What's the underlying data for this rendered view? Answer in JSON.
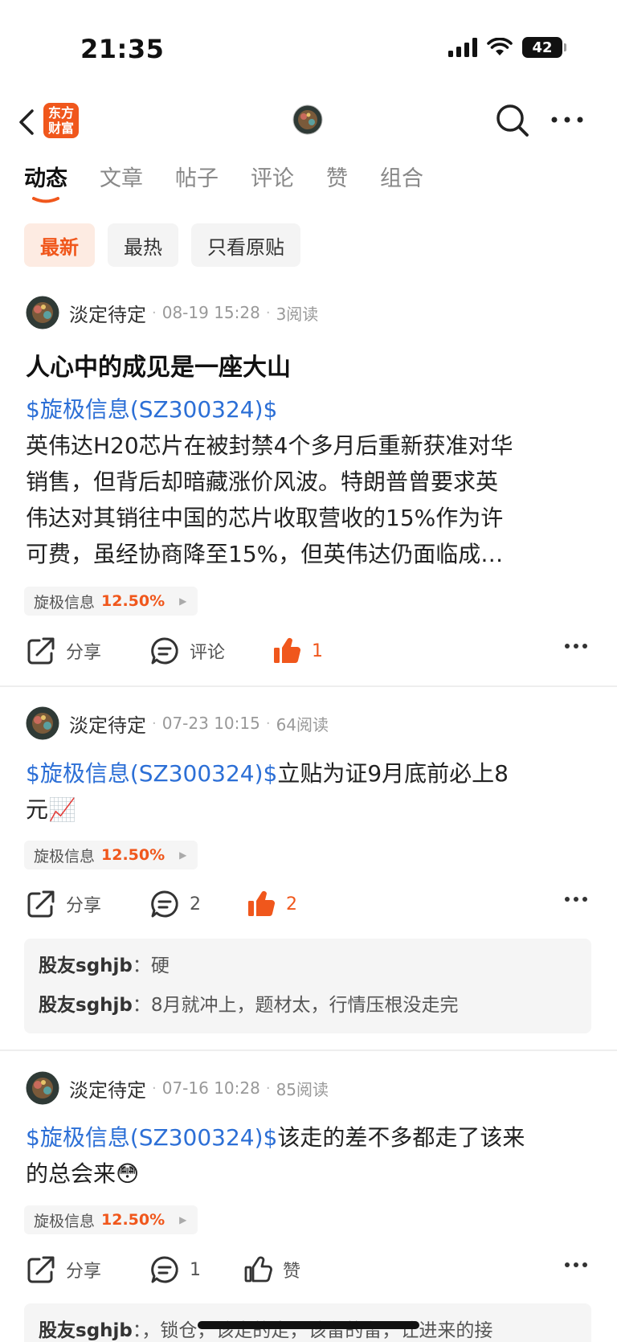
{
  "status_bar": {
    "time": "21:35",
    "battery": "42"
  },
  "nav": {
    "logo_line1": "东方",
    "logo_line2": "财富"
  },
  "tabs": [
    {
      "label": "动态"
    },
    {
      "label": "文章"
    },
    {
      "label": "帖子"
    },
    {
      "label": "评论"
    },
    {
      "label": "赞"
    },
    {
      "label": "组合"
    }
  ],
  "filters": [
    {
      "label": "最新"
    },
    {
      "label": "最热"
    },
    {
      "label": "只看原贴"
    }
  ],
  "colors": {
    "accent": "#f0571c",
    "link": "#2c6fd6"
  },
  "posts": [
    {
      "author": "淡定待定",
      "time": "08-19 15:28",
      "reads": "3阅读",
      "title": "人心中的成见是一座大山",
      "stock_link": "$旋极信息(SZ300324)$",
      "body_line1": "英伟达H20芯片在被封禁4个多月后重新获准对华",
      "body_line2": "销售，但背后却暗藏涨价风波。特朗普曾要求英",
      "body_line3": "伟达对其销往中国的芯片收取营收的15%作为许",
      "body_line4": "可费，虽经协商降至15%，但英伟达仍面临成…",
      "tag_name": "旋极信息",
      "tag_pct": "12.50%",
      "share": "分享",
      "comment": "评论",
      "likes": "1"
    },
    {
      "author": "淡定待定",
      "time": "07-23 10:15",
      "reads": "64阅读",
      "stock_link": "$旋极信息(SZ300324)$",
      "body_rest": "立贴为证9月底前必上8",
      "body_line2": "元📈",
      "tag_name": "旋极信息",
      "tag_pct": "12.50%",
      "share": "分享",
      "comments_count": "2",
      "likes": "2",
      "comments": [
        {
          "user": "股友sghjb",
          "text": "硬"
        },
        {
          "user": "股友sghjb",
          "text": "8月就冲上，题材太，行情压根没走完"
        }
      ]
    },
    {
      "author": "淡定待定",
      "time": "07-16 10:28",
      "reads": "85阅读",
      "stock_link": "$旋极信息(SZ300324)$",
      "body_rest": "该走的差不多都走了该来",
      "body_line2": "的总会来😳",
      "tag_name": "旋极信息",
      "tag_pct": "12.50%",
      "share": "分享",
      "comments_count": "1",
      "like_label": "赞",
      "comments": [
        {
          "user": "股友sghjb",
          "text": "，锁仓，该走的走，该留的留，让进来的接"
        }
      ]
    }
  ]
}
